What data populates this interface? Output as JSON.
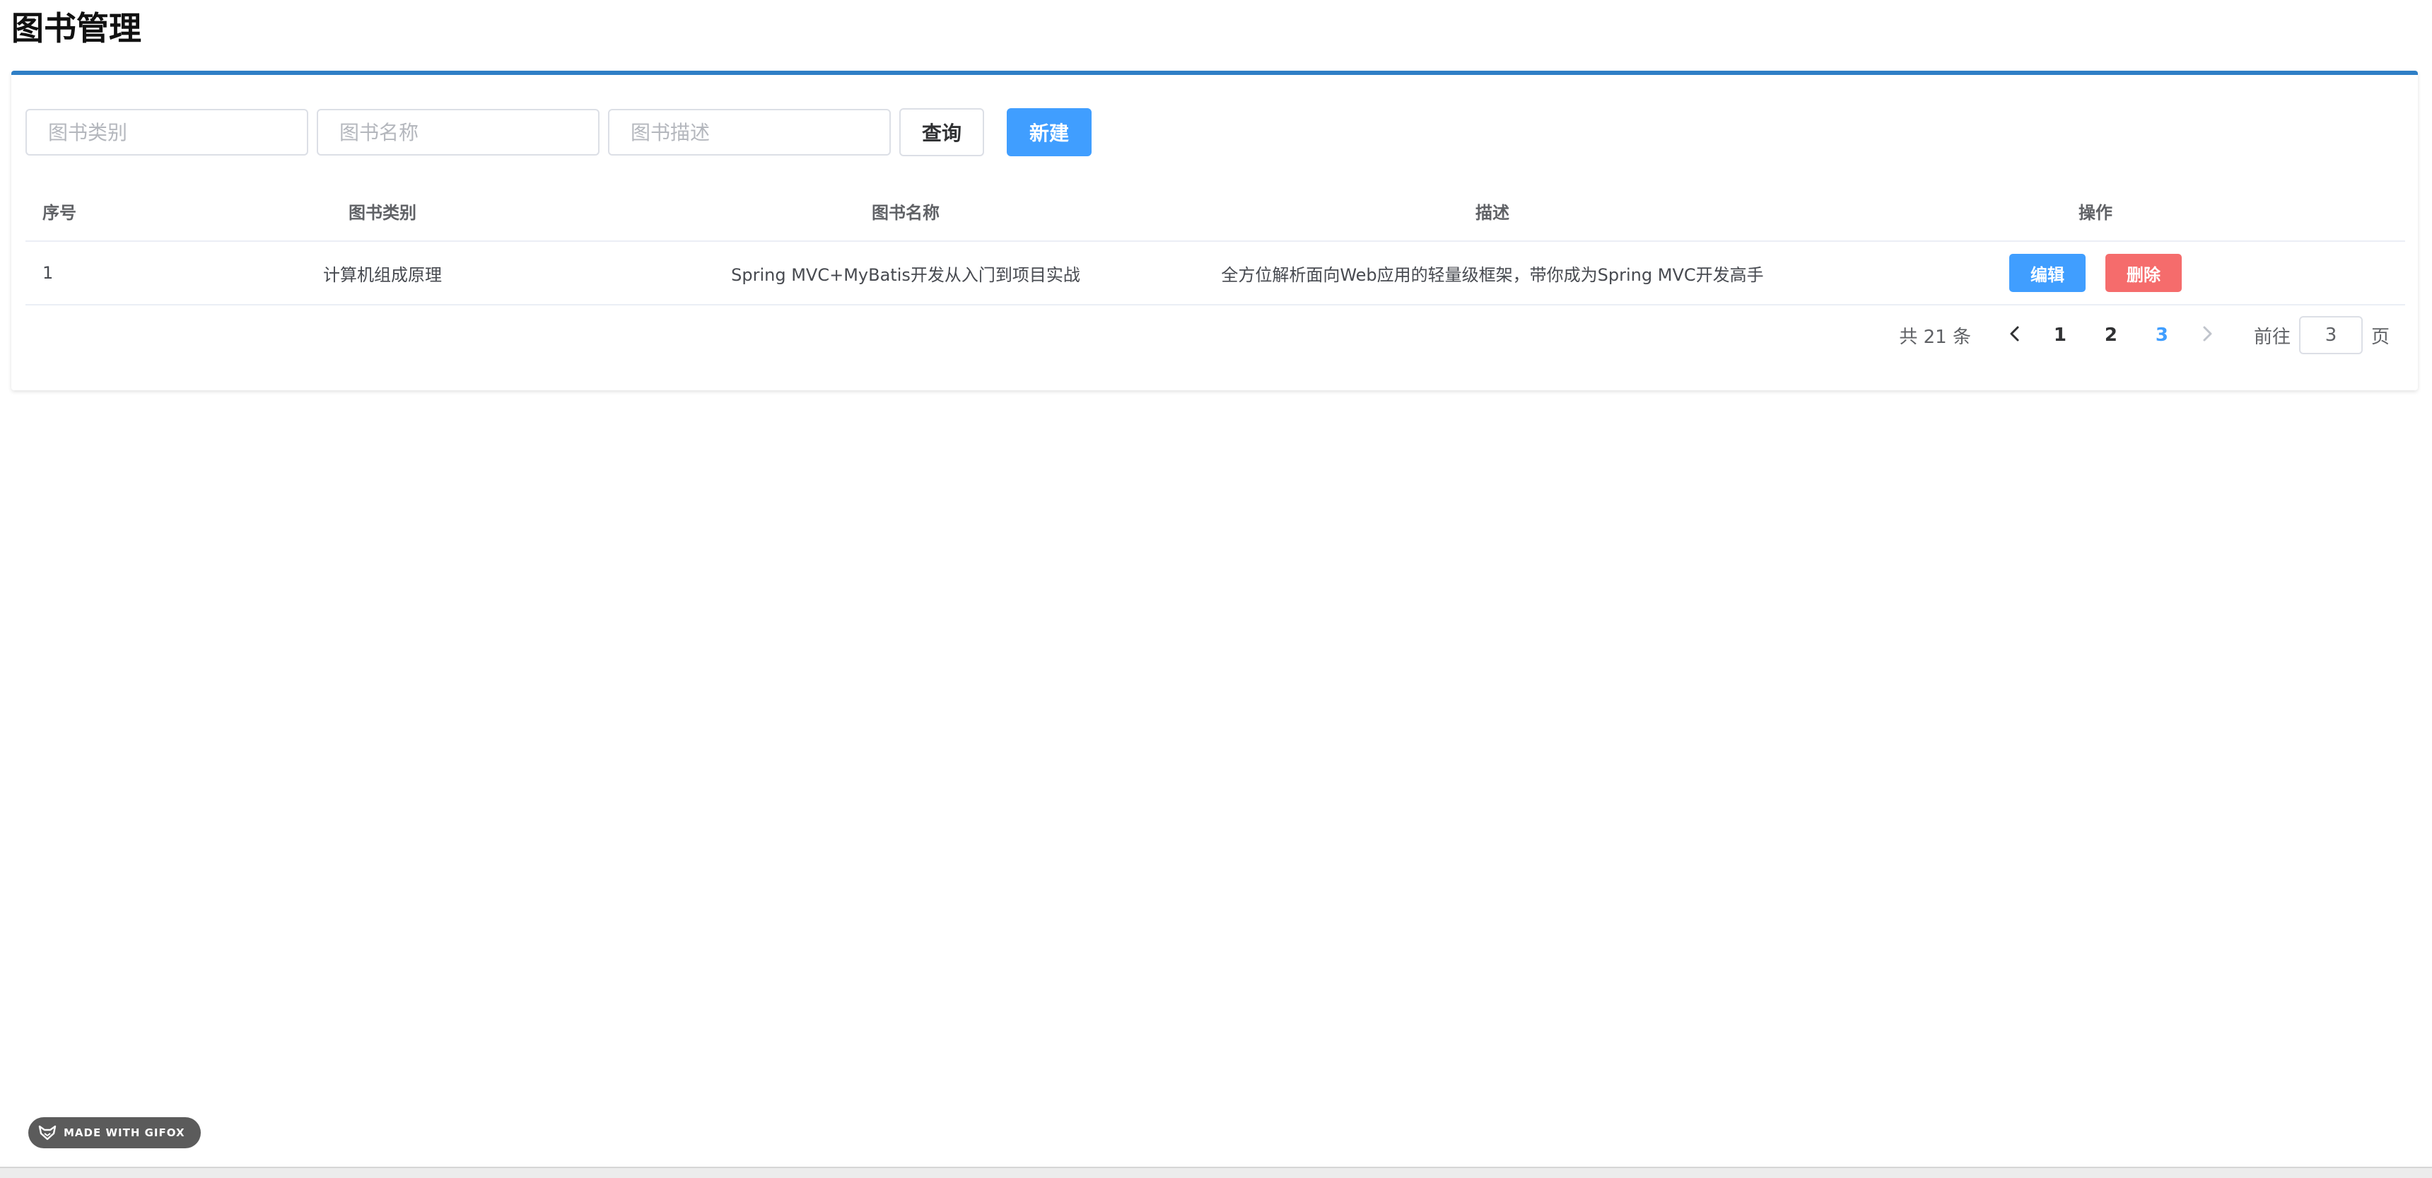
{
  "page": {
    "title": "图书管理"
  },
  "search": {
    "category_placeholder": "图书类别",
    "name_placeholder": "图书名称",
    "description_placeholder": "图书描述",
    "query_label": "查询",
    "new_label": "新建"
  },
  "table": {
    "headers": [
      "序号",
      "图书类别",
      "图书名称",
      "描述",
      "操作"
    ],
    "rows": [
      {
        "index": "1",
        "category": "计算机组成原理",
        "name": "Spring MVC+MyBatis开发从入门到项目实战",
        "description": "全方位解析面向Web应用的轻量级框架，带你成为Spring MVC开发高手",
        "edit_label": "编辑",
        "delete_label": "删除"
      }
    ]
  },
  "pagination": {
    "total_text": "共 21 条",
    "prev_icon": "chevron-left-icon",
    "pages": [
      "1",
      "2",
      "3"
    ],
    "current_page": "3",
    "next_icon": "chevron-right-icon",
    "goto_label": "前往",
    "goto_value": "3",
    "goto_unit": "页"
  },
  "badge": {
    "text": "MADE WITH GIFOX",
    "icon": "fox-icon"
  },
  "colors": {
    "primary": "#409eff",
    "danger": "#f56c6c",
    "card_border": "#2f7fc6"
  }
}
